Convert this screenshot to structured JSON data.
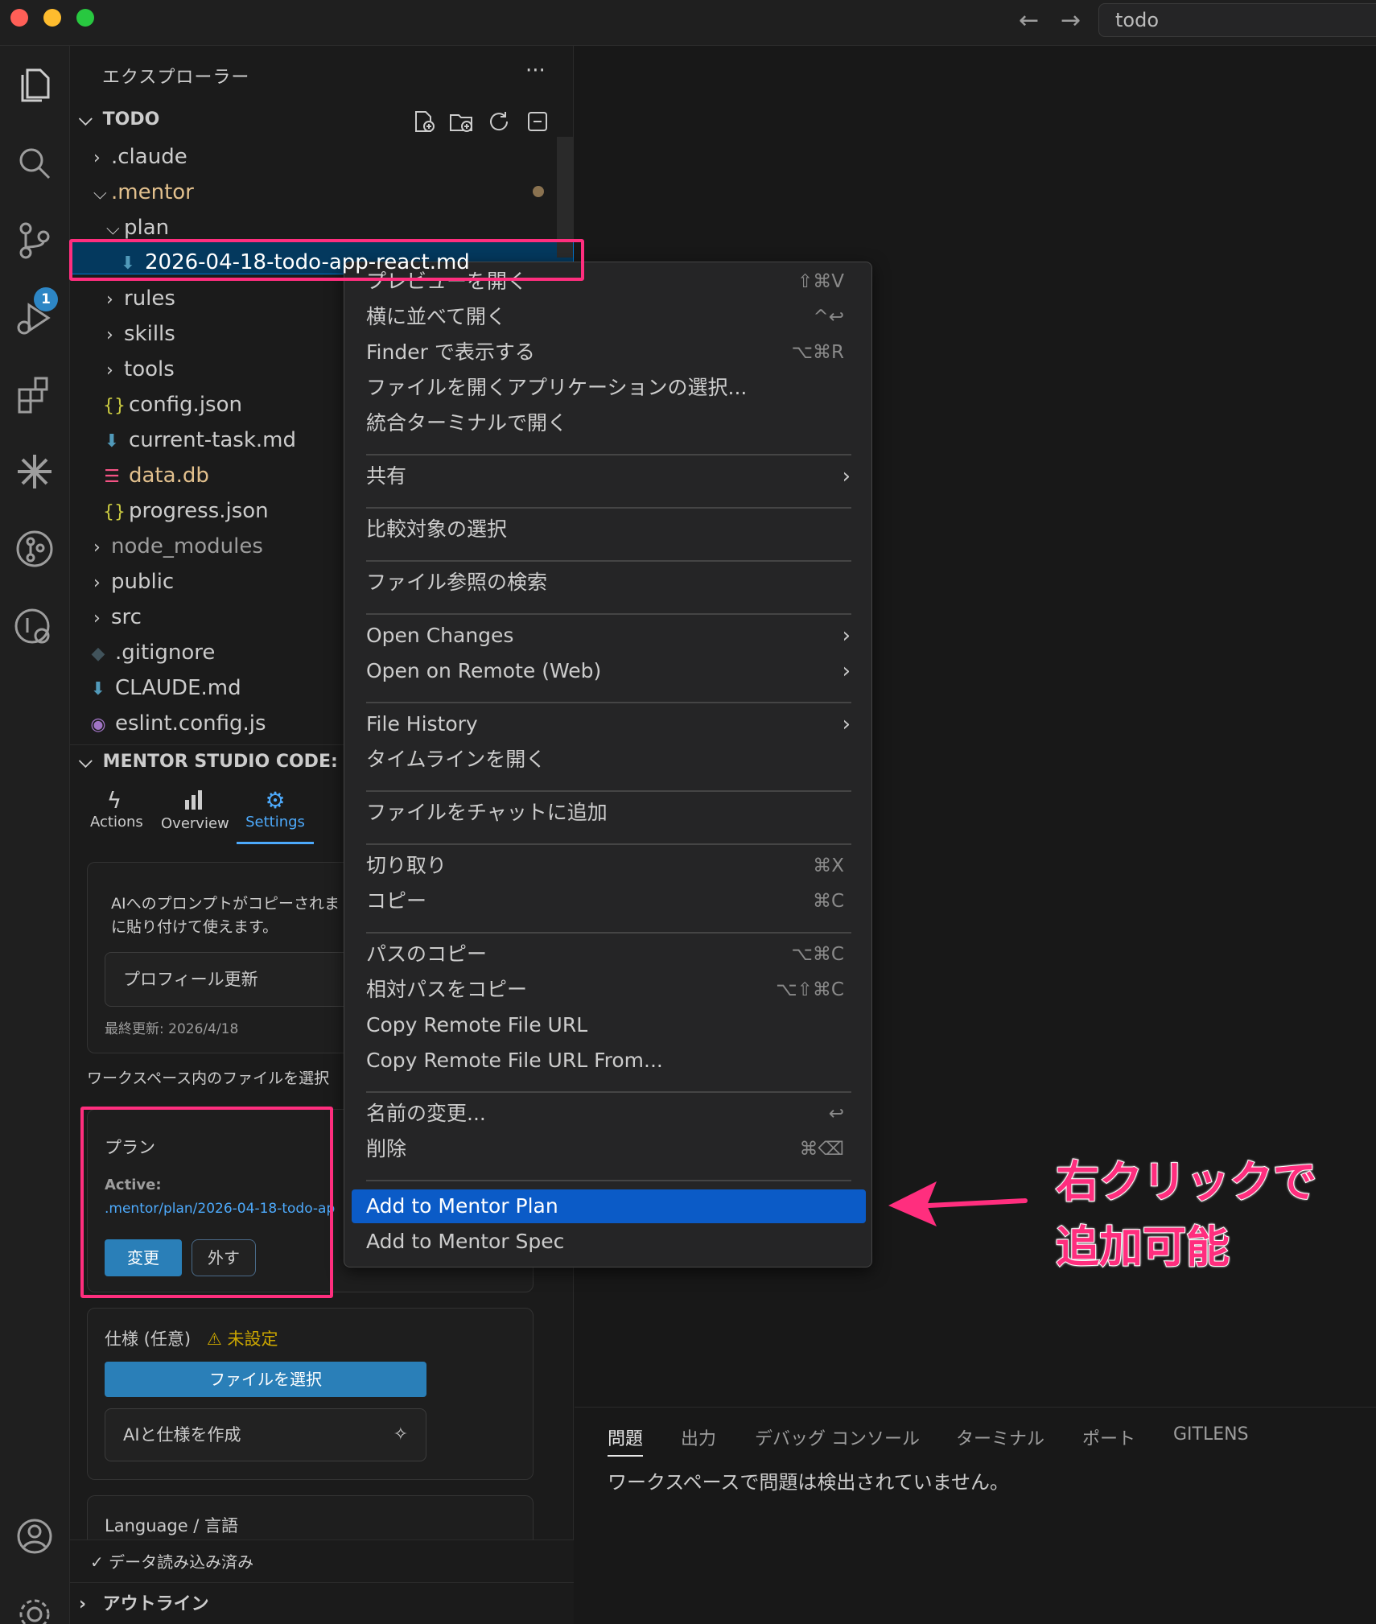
{
  "titlebar": {
    "search_text": "todo",
    "back_icon": "arrow-left-icon",
    "forward_icon": "arrow-right-icon",
    "traffic_lights": {
      "close": "#ff5f57",
      "minimize": "#febc2e",
      "maximize": "#28c840"
    }
  },
  "activity_bar": {
    "source_control_badge": "1",
    "icons": [
      "files-icon",
      "search-icon",
      "source-control-icon",
      "run-debug-icon",
      "extensions-icon",
      "mentor-spark-icon",
      "gitlens-icon",
      "gitlens-inspect-icon",
      "account-icon",
      "settings-gear-icon"
    ]
  },
  "explorer": {
    "title": "エクスプローラー",
    "more": "···",
    "root_label": "TODO",
    "tree": [
      {
        "label": ".claude",
        "kind": "folder"
      },
      {
        "label": ".mentor",
        "kind": "folder-open"
      },
      {
        "label": "plan",
        "kind": "folder-open"
      },
      {
        "label": "2026-04-18-todo-app-react.md",
        "kind": "md"
      },
      {
        "label": "rules",
        "kind": "folder"
      },
      {
        "label": "skills",
        "kind": "folder"
      },
      {
        "label": "tools",
        "kind": "folder"
      },
      {
        "label": "config.json",
        "kind": "json"
      },
      {
        "label": "current-task.md",
        "kind": "md"
      },
      {
        "label": "data.db",
        "kind": "db"
      },
      {
        "label": "progress.json",
        "kind": "json"
      },
      {
        "label": "node_modules",
        "kind": "folder"
      },
      {
        "label": "public",
        "kind": "folder"
      },
      {
        "label": "src",
        "kind": "folder"
      },
      {
        "label": ".gitignore",
        "kind": "git"
      },
      {
        "label": "CLAUDE.md",
        "kind": "md"
      },
      {
        "label": "eslint.config.js",
        "kind": "eslint"
      }
    ]
  },
  "mentor": {
    "header": "MENTOR STUDIO CODE:",
    "tabs": [
      {
        "label": "Actions",
        "icon": "lightning-icon"
      },
      {
        "label": "Overview",
        "icon": "bar-chart-icon"
      },
      {
        "label": "Settings",
        "icon": "gear-icon"
      }
    ],
    "prompt_text_line1": "AIへのプロンプトがコピーされま",
    "prompt_text_line2": "に貼り付けて使えます。",
    "profile_button": "プロフィール更新",
    "last_updated": "最終更新: 2026/4/18",
    "workspace_text": "ワークスペース内のファイルを選択",
    "plan": {
      "title": "プラン",
      "active_label": "Active:",
      "active_path": ".mentor/plan/2026-04-18-todo-ap",
      "change_button": "変更",
      "remove_button": "外す"
    },
    "spec": {
      "title": "仕様 (任意)",
      "status": "⚠ 未設定",
      "select_button": "ファイルを選択",
      "ai_button": "AIと仕様を作成"
    },
    "language_label": "Language / 言語",
    "data_loaded": "✓ データ読み込み済み"
  },
  "outline_label": "アウトライン",
  "panel": {
    "tabs": [
      "問題",
      "出力",
      "デバッグ コンソール",
      "ターミナル",
      "ポート",
      "GITLENS"
    ],
    "message": "ワークスペースで問題は検出されていません。"
  },
  "context_menu": {
    "items": [
      {
        "label": "プレビューを開く",
        "shortcut": "⇧⌘V"
      },
      {
        "label": "横に並べて開く",
        "shortcut": "^↩"
      },
      {
        "label": "Finder で表示する",
        "shortcut": "⌥⌘R"
      },
      {
        "label": "ファイルを開くアプリケーションの選択...",
        "shortcut": ""
      },
      {
        "label": "統合ターミナルで開く",
        "shortcut": ""
      },
      {
        "label": "共有",
        "shortcut": ""
      },
      {
        "label": "比較対象の選択",
        "shortcut": ""
      },
      {
        "label": "ファイル参照の検索",
        "shortcut": ""
      },
      {
        "label": "Open Changes",
        "shortcut": ""
      },
      {
        "label": "Open on Remote (Web)",
        "shortcut": ""
      },
      {
        "label": "File History",
        "shortcut": ""
      },
      {
        "label": "タイムラインを開く",
        "shortcut": ""
      },
      {
        "label": "ファイルをチャットに追加",
        "shortcut": ""
      },
      {
        "label": "切り取り",
        "shortcut": "⌘X"
      },
      {
        "label": "コピー",
        "shortcut": "⌘C"
      },
      {
        "label": "パスのコピー",
        "shortcut": "⌥⌘C"
      },
      {
        "label": "相対パスをコピー",
        "shortcut": "⌥⇧⌘C"
      },
      {
        "label": "Copy Remote File URL",
        "shortcut": ""
      },
      {
        "label": "Copy Remote File URL From...",
        "shortcut": ""
      },
      {
        "label": "名前の変更...",
        "shortcut": "↩"
      },
      {
        "label": "削除",
        "shortcut": "⌘⌫"
      },
      {
        "label": "Add to Mentor Plan",
        "shortcut": ""
      },
      {
        "label": "Add to Mentor Spec",
        "shortcut": ""
      }
    ],
    "highlighted": "Add to Mentor Plan"
  },
  "annotation": {
    "line1": "右クリックで",
    "line2": "追加可能",
    "color": "#ff2e7e"
  }
}
